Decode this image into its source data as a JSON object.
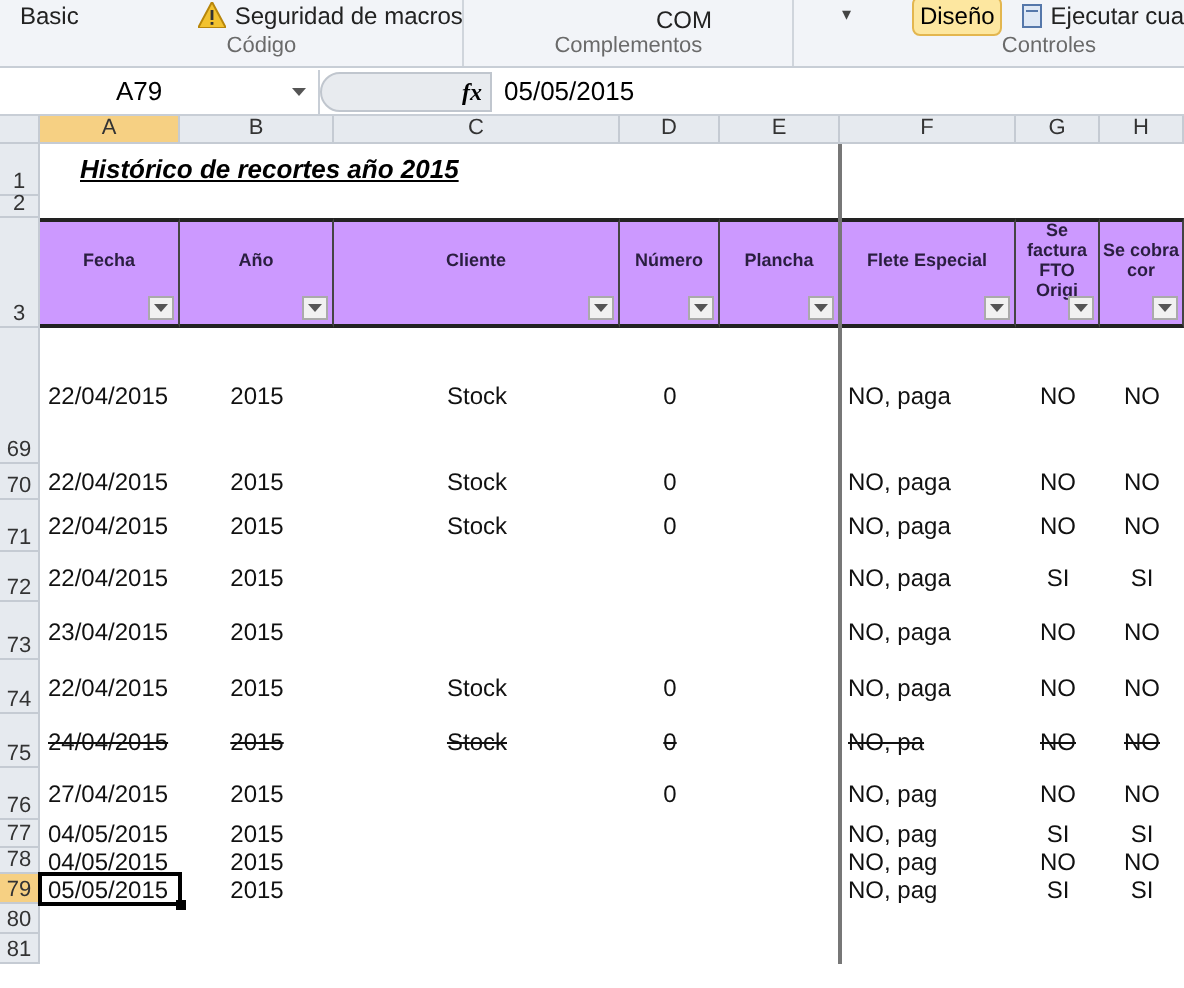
{
  "ribbon": {
    "items": [
      {
        "kind": "text",
        "label": "Basic"
      },
      {
        "kind": "warning",
        "label": "Seguridad de macros"
      },
      {
        "kind": "text",
        "label": "COM"
      },
      {
        "kind": "caret",
        "label": "▾"
      },
      {
        "kind": "toggle",
        "label": "Diseño",
        "selected": true
      },
      {
        "kind": "run",
        "label": "Ejecutar cua"
      }
    ],
    "groups": [
      "Código",
      "Complementos",
      "Controles"
    ]
  },
  "formula_bar": {
    "name_box": "A79",
    "fx": "fx",
    "value": "05/05/2015"
  },
  "columns": [
    {
      "label": "A",
      "selected": true
    },
    {
      "label": "B",
      "selected": false
    },
    {
      "label": "C",
      "selected": false
    },
    {
      "label": "D",
      "selected": false
    },
    {
      "label": "E",
      "selected": false
    },
    {
      "label": "F",
      "selected": false
    },
    {
      "label": "G",
      "selected": false
    },
    {
      "label": "H",
      "selected": false
    }
  ],
  "title_row": {
    "row": "1",
    "title": "Histórico de recortes año 2015"
  },
  "blank_row": {
    "row": "2"
  },
  "header_row": {
    "row": "3",
    "headings": [
      "Fecha",
      "Año",
      "Cliente",
      "Número",
      "Plancha",
      "Flete Especial",
      "Se factura FTO Origi",
      "Se cobra cor"
    ]
  },
  "rows": [
    {
      "row": "69",
      "struck": false,
      "selected": false,
      "cells": {
        "A": "22/04/2015",
        "B": "2015",
        "C": "Stock",
        "D": "0",
        "F": "NO, paga",
        "G": "NO",
        "H": "NO"
      }
    },
    {
      "row": "70",
      "struck": false,
      "selected": false,
      "cells": {
        "A": "22/04/2015",
        "B": "2015",
        "C": "Stock",
        "D": "0",
        "F": "NO, paga",
        "G": "NO",
        "H": "NO"
      }
    },
    {
      "row": "71",
      "struck": false,
      "selected": false,
      "cells": {
        "A": "22/04/2015",
        "B": "2015",
        "C": "Stock",
        "D": "0",
        "F": "NO, paga",
        "G": "NO",
        "H": "NO"
      }
    },
    {
      "row": "72",
      "struck": false,
      "selected": false,
      "cells": {
        "A": "22/04/2015",
        "B": "2015",
        "F": "NO, paga",
        "G": "SI",
        "H": "SI"
      }
    },
    {
      "row": "73",
      "struck": false,
      "selected": false,
      "cells": {
        "A": "23/04/2015",
        "B": "2015",
        "F": "NO, paga",
        "G": "NO",
        "H": "NO"
      }
    },
    {
      "row": "74",
      "struck": false,
      "selected": false,
      "cells": {
        "A": "22/04/2015",
        "B": "2015",
        "C": "Stock",
        "D": "0",
        "F": "NO, paga",
        "G": "NO",
        "H": "NO"
      }
    },
    {
      "row": "75",
      "struck": true,
      "selected": false,
      "cells": {
        "A": "24/04/2015",
        "B": "2015",
        "C": "Stock",
        "D": "0",
        "F": "NO, pa",
        "G": "NO",
        "H": "NO"
      }
    },
    {
      "row": "76",
      "struck": false,
      "selected": false,
      "cells": {
        "A": "27/04/2015",
        "B": "2015",
        "D": "0",
        "F": "NO, pag",
        "G": "NO",
        "H": "NO"
      }
    },
    {
      "row": "77",
      "struck": false,
      "selected": false,
      "cells": {
        "A": "04/05/2015",
        "B": "2015",
        "F": "NO, pag",
        "G": "SI",
        "H": "SI"
      }
    },
    {
      "row": "78",
      "struck": false,
      "selected": false,
      "cells": {
        "A": "04/05/2015",
        "B": "2015",
        "F": "NO, pag",
        "G": "NO",
        "H": "NO"
      }
    },
    {
      "row": "79",
      "struck": false,
      "selected": true,
      "cells": {
        "A": "05/05/2015",
        "B": "2015",
        "F": "NO, pag",
        "G": "SI",
        "H": "SI"
      }
    }
  ],
  "empty_rows": [
    "80",
    "81"
  ]
}
